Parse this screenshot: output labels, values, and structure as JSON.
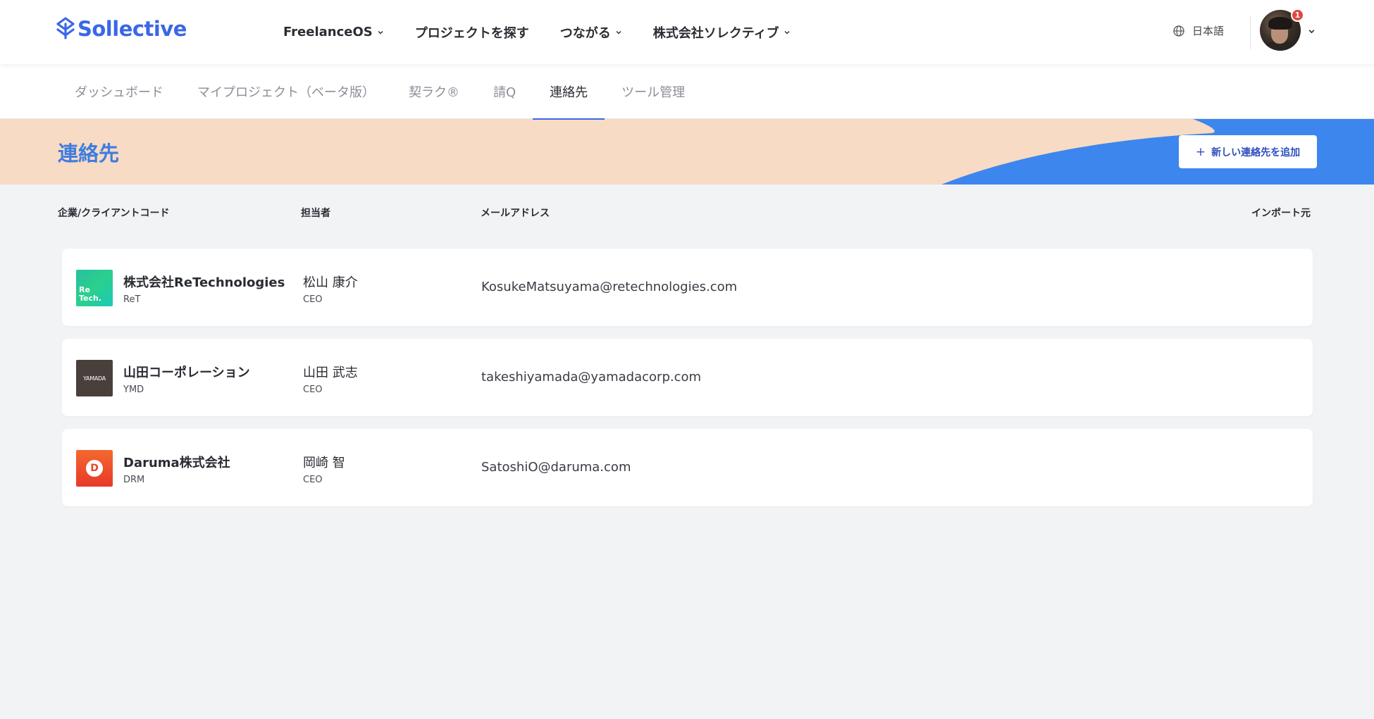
{
  "header": {
    "logo_text": "Sollective",
    "nav": [
      {
        "label": "FreelanceOS",
        "has_dropdown": true
      },
      {
        "label": "プロジェクトを探す",
        "has_dropdown": false
      },
      {
        "label": "つながる",
        "has_dropdown": true
      },
      {
        "label": "株式会社ソレクティブ",
        "has_dropdown": true
      }
    ],
    "language": "日本語",
    "notification_count": "1"
  },
  "subnav": {
    "tabs": [
      {
        "label": "ダッシュボード",
        "active": false
      },
      {
        "label": "マイプロジェクト（ベータ版）",
        "active": false
      },
      {
        "label": "契ラク®",
        "active": false
      },
      {
        "label": "請Q",
        "active": false
      },
      {
        "label": "連絡先",
        "active": true
      },
      {
        "label": "ツール管理",
        "active": false
      }
    ]
  },
  "page": {
    "title": "連絡先",
    "add_button_label": "新しい連絡先を追加",
    "add_button_icon": "plus-icon"
  },
  "table": {
    "columns": {
      "company": "企業/クライアントコード",
      "person": "担当者",
      "email": "メールアドレス",
      "import": "インポート元"
    },
    "rows": [
      {
        "company": "株式会社ReTechnologies",
        "code": "ReT",
        "person": "松山 康介",
        "role": "CEO",
        "email": "KosukeMatsuyama@retechnologies.com",
        "logo_text": "Re Tech."
      },
      {
        "company": "山田コーポレーション",
        "code": "YMD",
        "person": "山田 武志",
        "role": "CEO",
        "email": "takeshiyamada@yamadacorp.com",
        "logo_text": "YAMADA"
      },
      {
        "company": "Daruma株式会社",
        "code": "DRM",
        "person": "岡崎 智",
        "role": "CEO",
        "email": "SatoshiO@daruma.com",
        "logo_text": "D"
      }
    ]
  },
  "colors": {
    "brand_blue": "#3a67e6",
    "hero_peach": "#f7dbc4",
    "hero_blue": "#3d86ee",
    "title_blue": "#3f7de0"
  }
}
